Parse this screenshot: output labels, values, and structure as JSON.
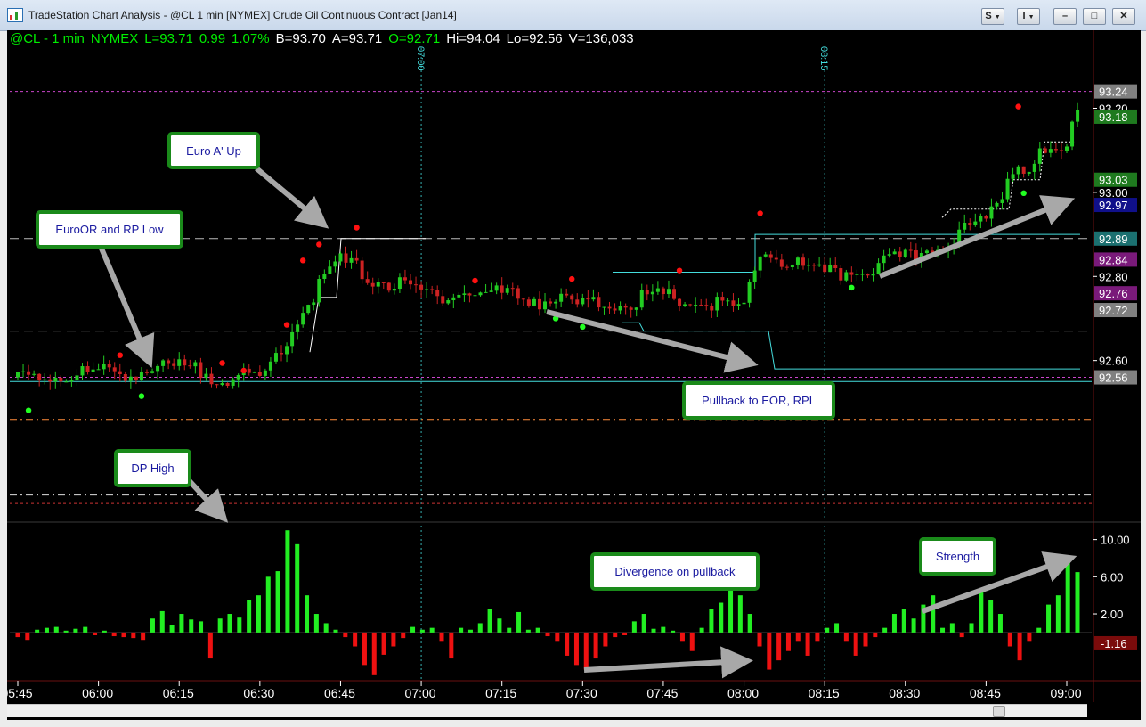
{
  "window": {
    "title": "TradeStation Chart Analysis - @CL 1 min [NYMEX] Crude Oil Continuous Contract [Jan14]",
    "buttons": {
      "s": "S",
      "i": "I"
    },
    "minimize_label": "–",
    "maximize_label": "□",
    "close_label": "✕"
  },
  "status": {
    "symbol": "@CL - 1 min",
    "exchange": "NYMEX",
    "last": "L=93.71",
    "change": "0.99",
    "pct": "1.07%",
    "bid": "B=93.70",
    "ask": "A=93.71",
    "open": "O=92.71",
    "high": "Hi=94.04",
    "low": "Lo=92.56",
    "volume": "V=136,033"
  },
  "colors": {
    "status_green": "#00ee00",
    "status_white": "#ffffff",
    "up": "#22cc22",
    "down": "#cc2222",
    "cyan": "#44dddd",
    "magenta": "#cc44cc",
    "orange": "#ff8c3a",
    "callout_border": "#1a8a1a",
    "callout_text": "#1a1aa0"
  },
  "callouts": {
    "euro_a_up": "Euro A' Up",
    "euro_or": "EuroOR and RP Low",
    "dp_high": "DP High",
    "pullback": "Pullback to EOR, RPL",
    "divergence": "Divergence on pullback",
    "strength": "Strength"
  },
  "chart_data": [
    {
      "type": "line",
      "title": "@CL 1 min [NYMEX] Crude Oil Continuous Contract [Jan14]",
      "x_labels": [
        "05:45",
        "06:00",
        "06:15",
        "06:30",
        "06:45",
        "07:00",
        "07:15",
        "07:30",
        "07:45",
        "08:00",
        "08:15",
        "08:30",
        "08:45",
        "09:00"
      ],
      "y_ticks": [
        92.4,
        92.6,
        92.8,
        93.0,
        93.2
      ],
      "ylim": [
        92.22,
        93.36
      ],
      "right_axis_labels": [
        {
          "value": "93.24",
          "color": "#808080"
        },
        {
          "value": "93.20",
          "color": "#000000"
        },
        {
          "value": "93.18",
          "color": "#1f7a1f"
        },
        {
          "value": "93.03",
          "color": "#1f7a1f"
        },
        {
          "value": "93.00",
          "color": "#000000"
        },
        {
          "value": "92.97",
          "color": "#10108a"
        },
        {
          "value": "92.89",
          "color": "#1b7070"
        },
        {
          "value": "92.84",
          "color": "#7a1a7a"
        },
        {
          "value": "92.80",
          "color": "#000000"
        },
        {
          "value": "92.76",
          "color": "#7a1a7a"
        },
        {
          "value": "92.72",
          "color": "#808080"
        },
        {
          "value": "92.60",
          "color": "#000000"
        },
        {
          "value": "92.56",
          "color": "#808080"
        }
      ],
      "close_series": [
        {
          "time": "05:45",
          "close": 92.56
        },
        {
          "time": "06:00",
          "close": 92.57
        },
        {
          "time": "06:15",
          "close": 92.58
        },
        {
          "time": "06:30",
          "close": 92.55
        },
        {
          "time": "06:40",
          "close": 92.76
        },
        {
          "time": "06:45",
          "close": 92.84
        },
        {
          "time": "06:50",
          "close": 92.8
        },
        {
          "time": "07:00",
          "close": 92.76
        },
        {
          "time": "07:15",
          "close": 92.76
        },
        {
          "time": "07:30",
          "close": 92.73
        },
        {
          "time": "07:45",
          "close": 92.75
        },
        {
          "time": "08:00",
          "close": 92.72
        },
        {
          "time": "08:03",
          "close": 92.86
        },
        {
          "time": "08:15",
          "close": 92.8
        },
        {
          "time": "08:30",
          "close": 92.84
        },
        {
          "time": "08:45",
          "close": 92.93
        },
        {
          "time": "08:50",
          "close": 93.06
        },
        {
          "time": "09:00",
          "close": 93.1
        },
        {
          "time": "09:02",
          "close": 93.22
        }
      ],
      "vertical_markers": [
        "07:00",
        "08:15"
      ]
    },
    {
      "type": "bar",
      "title": "",
      "x_labels": [
        "05:45",
        "06:00",
        "06:15",
        "06:30",
        "06:45",
        "07:00",
        "07:15",
        "07:30",
        "07:45",
        "08:00",
        "08:15",
        "08:30",
        "08:45",
        "09:00"
      ],
      "y_ticks": [
        10.0,
        6.0,
        2.0
      ],
      "ylim": [
        -5.0,
        11.5
      ],
      "last_value": "-1.16",
      "values": [
        -0.5,
        -0.8,
        0.3,
        0.5,
        0.6,
        0.2,
        0.4,
        0.6,
        -0.3,
        0.2,
        -0.4,
        -0.5,
        -0.6,
        -0.8,
        1.5,
        2.3,
        0.8,
        2.0,
        1.4,
        1.2,
        -2.8,
        1.5,
        2.0,
        1.6,
        3.5,
        4.0,
        6.0,
        6.6,
        11.0,
        9.5,
        4.0,
        2.0,
        1.0,
        0.3,
        -0.5,
        -1.5,
        -3.5,
        -4.6,
        -2.4,
        -1.5,
        -0.6,
        0.6,
        0.3,
        0.5,
        -1.0,
        -2.8,
        0.5,
        0.3,
        1.0,
        2.5,
        1.5,
        0.5,
        2.2,
        0.3,
        0.5,
        -0.4,
        -1.0,
        -2.5,
        -3.5,
        -4.0,
        -2.8,
        -1.5,
        -0.5,
        -0.3,
        1.2,
        2.0,
        0.4,
        0.6,
        0.2,
        -1.0,
        -2.0,
        0.5,
        2.5,
        3.2,
        6.0,
        4.0,
        2.0,
        -1.5,
        -4.0,
        -3.0,
        -2.0,
        -1.0,
        -2.5,
        -1.0,
        0.5,
        1.0,
        -1.0,
        -2.5,
        -1.5,
        -0.5,
        0.5,
        2.0,
        2.5,
        1.5,
        3.0,
        4.0,
        0.5,
        1.0,
        -0.5,
        1.0,
        4.5,
        3.5,
        2.0,
        -1.5,
        -3.0,
        -1.0,
        0.5,
        3.0,
        4.0,
        8.0,
        6.5
      ]
    }
  ]
}
